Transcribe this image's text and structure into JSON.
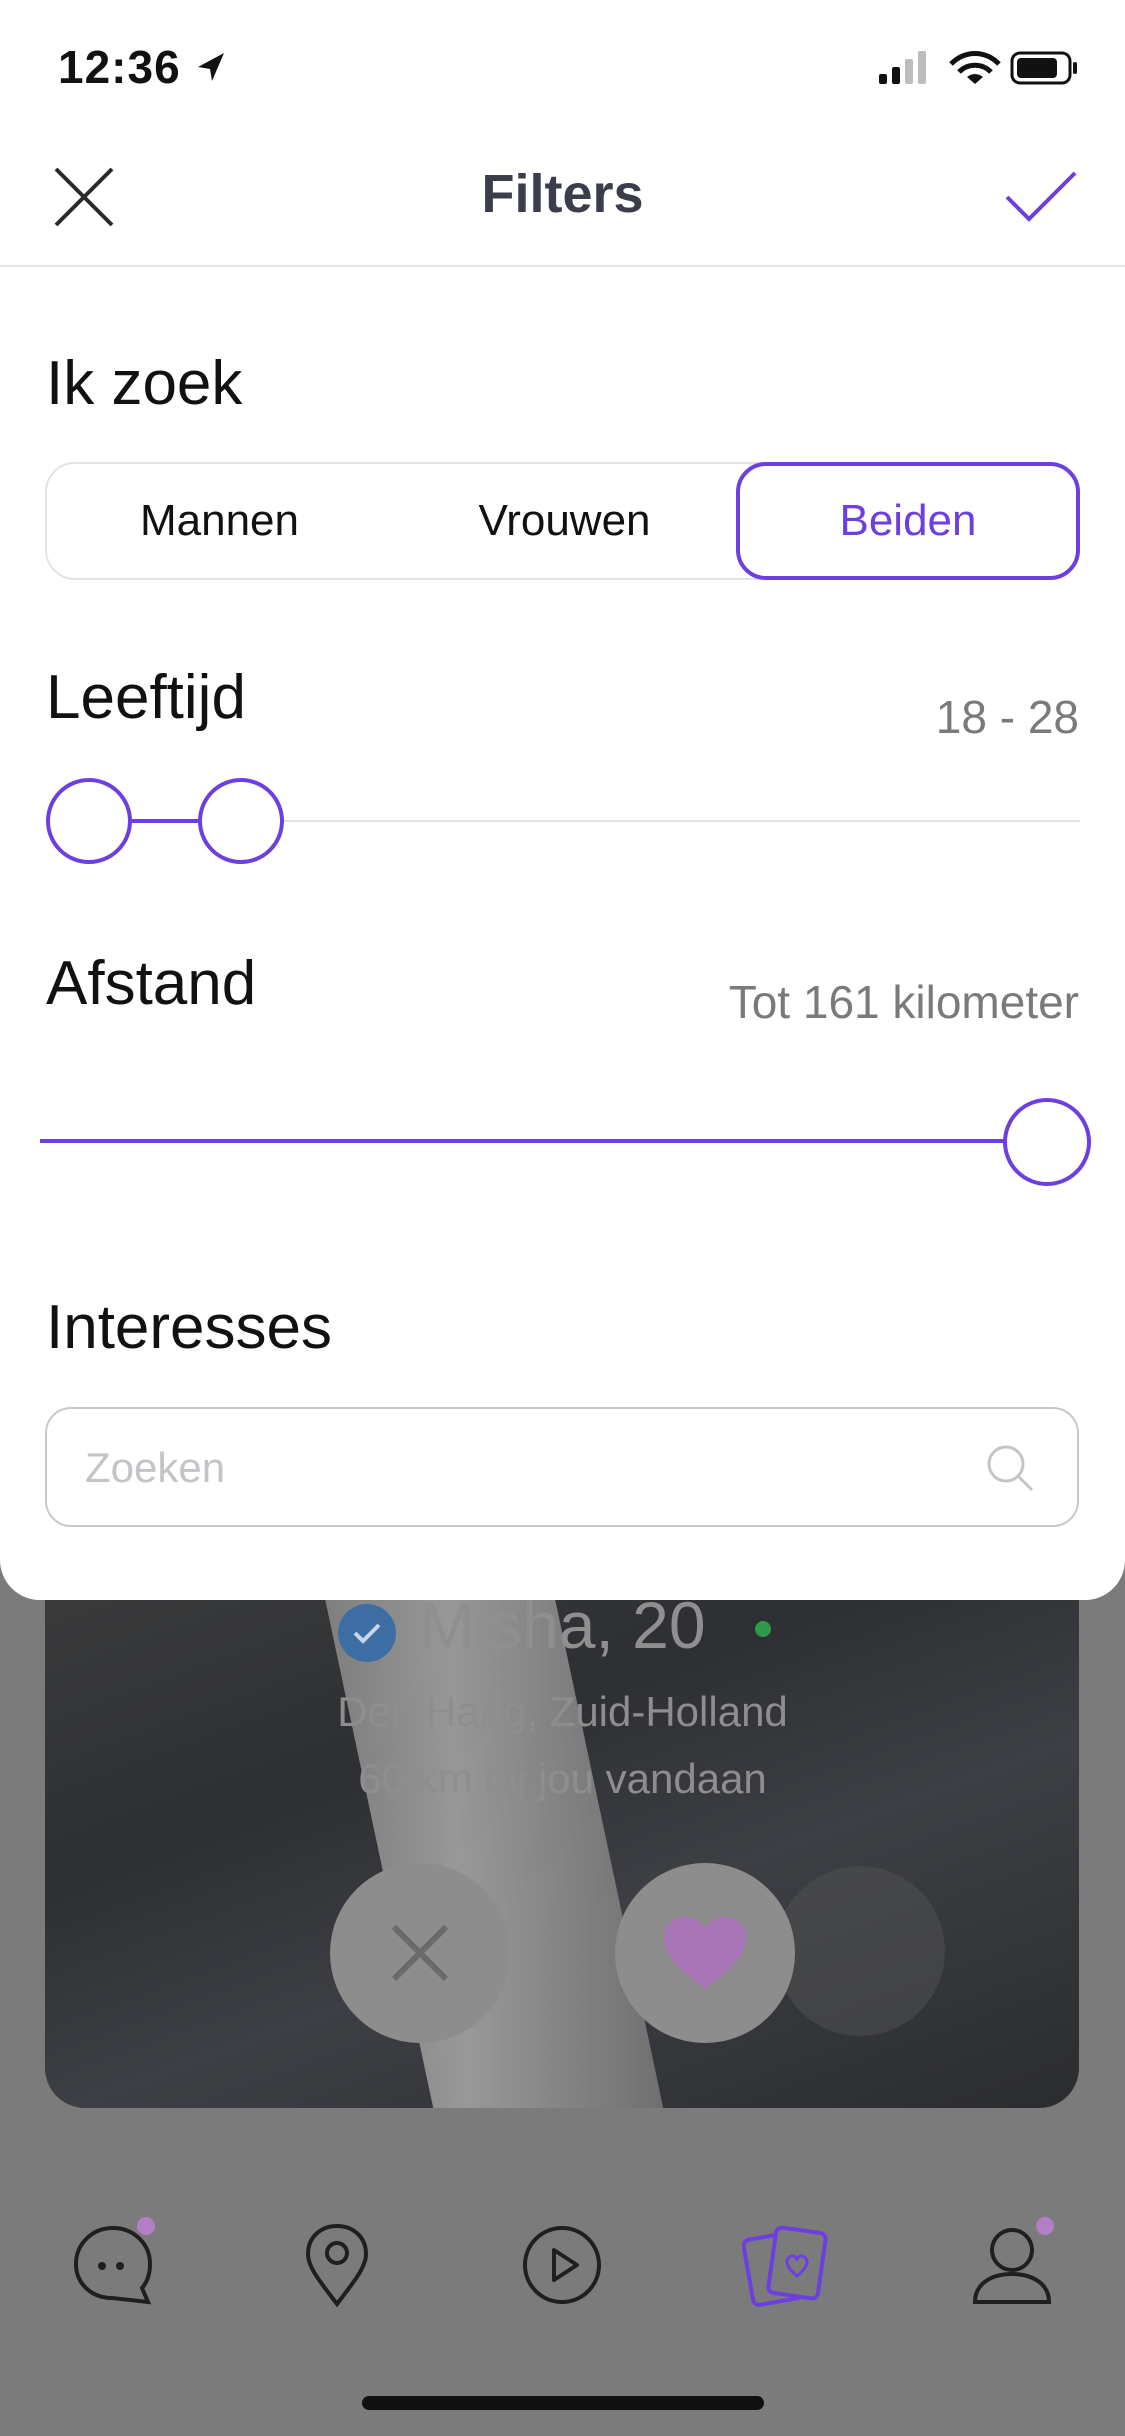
{
  "status_bar": {
    "time": "12:36"
  },
  "header": {
    "title": "Filters",
    "close_icon": "close-icon",
    "confirm_icon": "checkmark-icon"
  },
  "looking_for": {
    "title": "Ik zoek",
    "options": [
      "Mannen",
      "Vrouwen",
      "Beiden"
    ],
    "selected": "Beiden"
  },
  "age": {
    "title": "Leeftijd",
    "value_text": "18 - 28",
    "min": 18,
    "max": 28
  },
  "distance": {
    "title": "Afstand",
    "value_text": "Tot 161 kilometer",
    "value_km": 161,
    "fill_fraction": 1.0
  },
  "interests": {
    "title": "Interesses",
    "search_placeholder": "Zoeken"
  },
  "background_profile": {
    "name_age": "Misha, 20",
    "location": "Den Haag, Zuid-Holland",
    "distance_text": "60 km bij jou vandaan"
  },
  "tabbar": {
    "items": [
      "chat-icon",
      "location-pin-icon",
      "play-icon",
      "cards-icon",
      "profile-icon"
    ],
    "active": "cards-icon"
  },
  "colors": {
    "accent": "#6d3fe0",
    "text": "#111111",
    "muted": "#7a7a7a",
    "overlay": "#7b7b7b"
  }
}
